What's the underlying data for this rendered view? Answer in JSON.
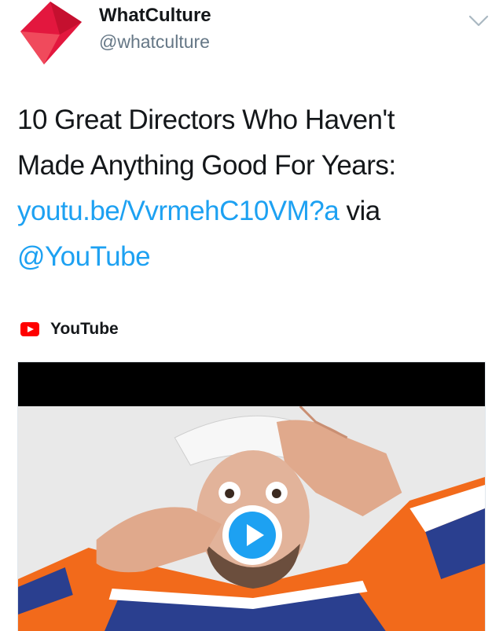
{
  "account": {
    "name": "WhatCulture",
    "handle": "@whatculture"
  },
  "tweet": {
    "text_line1": "10 Great Directors Who Haven't",
    "text_line2": "Made Anything Good For Years:",
    "link": "youtu.be/VvrmehC10VM?a",
    "via": " via",
    "mention": "@YouTube"
  },
  "card": {
    "source": "YouTube"
  },
  "colors": {
    "link": "#1da1f2",
    "youtube_red": "#ff0000",
    "brand_red": "#e3173e",
    "play_blue": "#1da1f2"
  },
  "icons": {
    "avatar": "whatculture-logo",
    "caret": "chevron-down-icon",
    "source": "youtube-icon",
    "play": "play-icon"
  }
}
